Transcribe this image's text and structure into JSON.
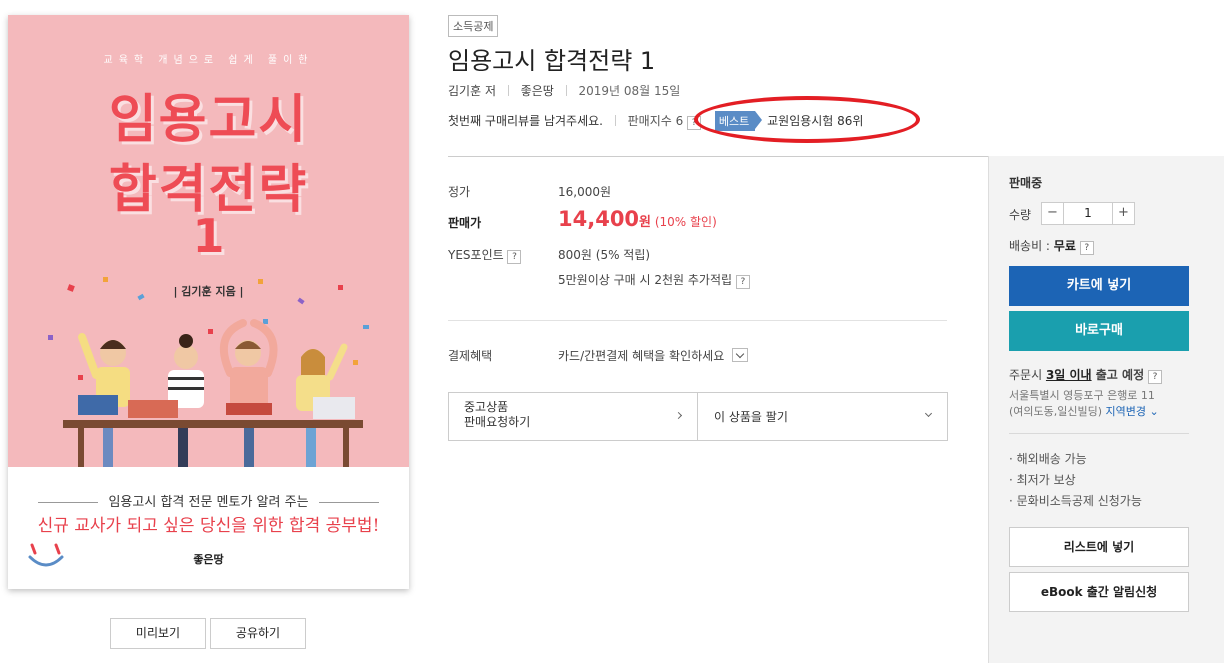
{
  "cover": {
    "top_text": "교육학 개념으로 쉽게 풀이한",
    "title_line1": "임용고시",
    "title_line2": "합격전략",
    "title_line3": "1",
    "author": "| 김기훈 지음 |",
    "subtitle": "임용고시 합격 전문 멘토가 알려 주는",
    "tagline": "신규 교사가 되고 싶은 당신을 위한 합격 공부법!",
    "publisher": "좋은땅",
    "preview_label": "미리보기",
    "share_label": "공유하기"
  },
  "product": {
    "badge": "소득공제",
    "title": "임용고시 합격전략 1",
    "author": "김기훈",
    "author_suffix": "저",
    "publisher": "좋은땅",
    "date": "2019년 08월 15일",
    "review_prompt": "첫번째 구매리뷰를 남겨주세요.",
    "sales_index_label": "판매지수 6",
    "help_mark": "?",
    "best_label": "베스트",
    "best_rank": "교원임용시험 86위"
  },
  "price": {
    "list_label": "정가",
    "list_value": "16,000원",
    "sale_label": "판매가",
    "sale_value": "14,400",
    "sale_unit": "원",
    "discount": "(10% 할인)",
    "points_label": "YES포인트",
    "points_value": "800원 (5% 적립)",
    "points_extra": "5만원이상 구매 시 2천원 추가적립",
    "payment_label": "결제혜택",
    "payment_value": "카드/간편결제 혜택을 확인하세요"
  },
  "used": {
    "left_line1": "중고상품",
    "left_line2": "판매요청하기",
    "right": "이 상품을 팔기"
  },
  "side": {
    "status": "판매중",
    "qty_label": "수량",
    "qty_minus": "−",
    "qty_value": "1",
    "qty_plus": "+",
    "ship_label": "배송비 : ",
    "ship_value": "무료",
    "cart_button": "카트에 넣기",
    "buy_button": "바로구매",
    "eta_prefix": "주문시 ",
    "eta_bold": "3일 이내",
    "eta_suffix": " 출고 예정",
    "addr_line1": "서울특별시 영등포구 은행로 11",
    "addr_line2": "(여의도동,일신빌딩)",
    "addr_change": "지역변경",
    "bullets": [
      "· 해외배송 가능",
      "· 최저가 보상",
      "· 문화비소득공제 신청가능"
    ],
    "wishlist_button": "리스트에 넣기",
    "ebook_button": "eBook 출간 알림신청"
  }
}
